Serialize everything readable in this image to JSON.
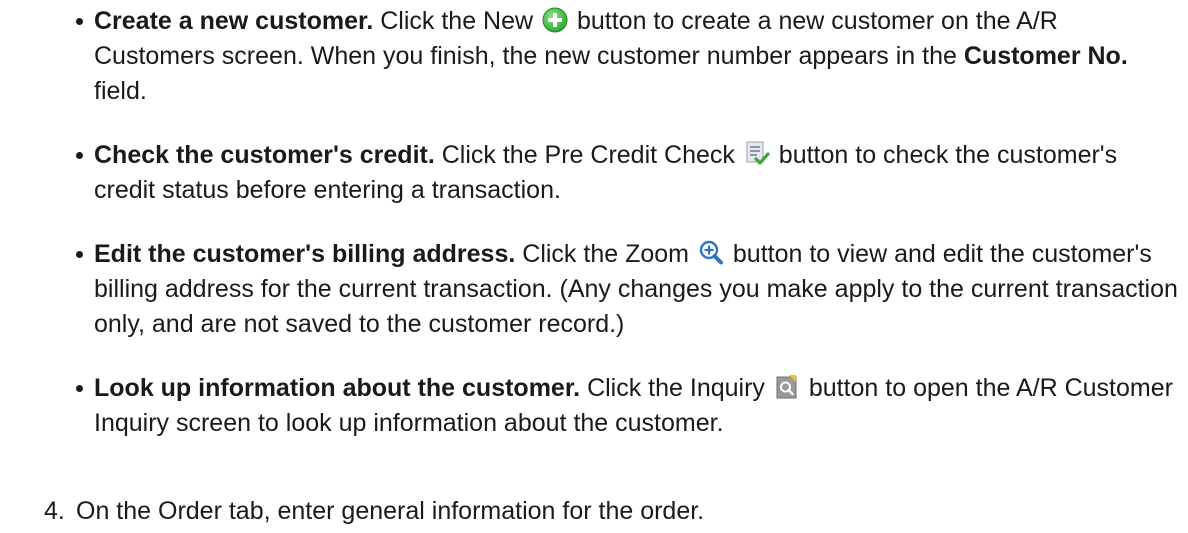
{
  "bullets": [
    {
      "lead": "Create a new customer.",
      "before": " Click the New ",
      "after": " button to create a new customer on the A/R Customers screen. When you finish, the new customer number appears in the ",
      "bold_field": "Customer No.",
      "tail": " field.",
      "icon": "plus-circle-icon"
    },
    {
      "lead": "Check the customer's credit.",
      "before": " Click the Pre Credit Check ",
      "after": " button to check the customer's credit status before entering a transaction.",
      "icon": "credit-check-icon"
    },
    {
      "lead": "Edit the customer's billing address.",
      "before": " Click the Zoom ",
      "after": " button to view and edit the customer's billing address for the current transaction. (Any changes you make apply to the current transaction only, and are not saved to the customer record.)",
      "icon": "zoom-icon"
    },
    {
      "lead": "Look up information about the customer.",
      "before": " Click the Inquiry ",
      "after": " button to open the A/R Customer Inquiry screen to look up information about the customer.",
      "icon": "inquiry-icon"
    }
  ],
  "step": {
    "number": "4.",
    "text": "On the Order tab, enter general information for the order."
  },
  "colors": {
    "text": "#1a1a1a",
    "new_icon_green": "#3fbf3f",
    "check_green": "#3aa935",
    "zoom_blue": "#2f73c9",
    "inquiry_gray": "#8a8a8a"
  }
}
